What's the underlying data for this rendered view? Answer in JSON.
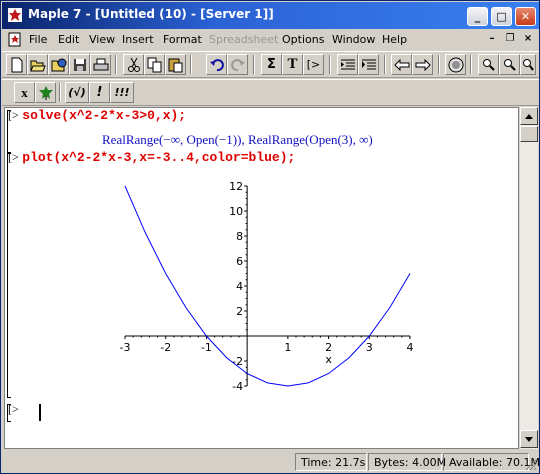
{
  "window": {
    "title": "Maple 7  - [Untitled (10) - [Server 1]]",
    "controls": {
      "minimize": "_",
      "maximize": "□",
      "close": "✕"
    }
  },
  "menu": {
    "items": [
      "File",
      "Edit",
      "View",
      "Insert",
      "Format",
      "Spreadsheet",
      "Options",
      "Window",
      "Help"
    ],
    "disabled": [
      "Spreadsheet"
    ],
    "mdi_controls": {
      "minimize": "–",
      "restore": "❐",
      "close": "×"
    }
  },
  "toolbar": {
    "icons": [
      "new-file-icon",
      "open-file-icon",
      "open-url-icon",
      "save-icon",
      "print-icon",
      "cut-icon",
      "copy-icon",
      "paste-icon",
      "undo-icon",
      "redo-icon",
      "sum-icon",
      "text-icon",
      "input-icon",
      "execute-icon",
      "execute-all-icon",
      "back-icon",
      "forward-icon",
      "stop-icon",
      "zoom-in-icon",
      "zoom-out-icon"
    ],
    "sum_label": "Σ",
    "text_label": "T",
    "input_label": "[>"
  },
  "context_toolbar": {
    "x_label": "x",
    "eval_label": "(√)",
    "bang_label": "!",
    "triple_label": "!!!"
  },
  "worksheet": {
    "prompt": "[>",
    "input1": "solve(x^2-2*x-3>0,x);",
    "output1": "RealRange(−∞, Open(−1)), RealRange(Open(3), ∞)",
    "input2": "plot(x^2-2*x-3,x=-3..4,color=blue);",
    "empty_prompt": "[>"
  },
  "chart_data": {
    "type": "line",
    "title": "",
    "xlabel": "x",
    "ylabel": "",
    "function": "x^2-2*x-3",
    "xlim": [
      -3,
      4
    ],
    "ylim": [
      -4,
      12
    ],
    "x_ticks": [
      "-3",
      "-2",
      "-1",
      "1",
      "2",
      "3",
      "4"
    ],
    "y_ticks": [
      "12",
      "10",
      "8",
      "6",
      "4",
      "2",
      "-2",
      "-4"
    ],
    "series": [
      {
        "color": "#0000ff",
        "x": [
          -3,
          -2.5,
          -2,
          -1.5,
          -1,
          -0.5,
          0,
          0.5,
          1,
          1.5,
          2,
          2.5,
          3,
          3.5,
          4
        ],
        "values": [
          12,
          8.25,
          5,
          2.25,
          0,
          -1.75,
          -3,
          -3.75,
          -4,
          -3.75,
          -3,
          -1.75,
          0,
          2.25,
          5
        ]
      }
    ]
  },
  "status": {
    "time": "Time:  21.7s",
    "bytes": "Bytes: 4.00M",
    "available": "Available: 70.1M"
  }
}
